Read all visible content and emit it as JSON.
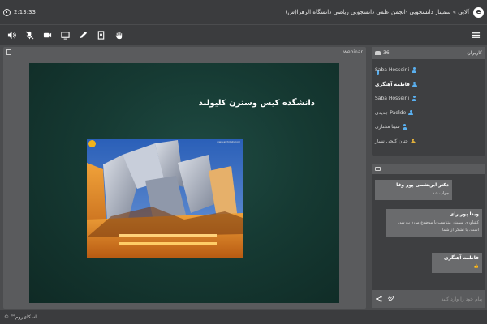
{
  "header": {
    "timer": "2:13:33",
    "breadcrumb": "آلابی » سمینار دانشجویی -انجمن علمی دانشجویی ریاضی دانشگاه الزهرا(س)",
    "logo_letter": "e"
  },
  "toolbar": {
    "icons": [
      "speaker-icon",
      "mic-off-icon",
      "camera-icon",
      "screen-share-icon",
      "pen-icon",
      "document-icon",
      "raise-hand-icon"
    ],
    "menu_icon": "hamburger-menu-icon"
  },
  "presentation": {
    "header_label": "webinar",
    "slide_title": "دانشگده کیس وسترن کلیولند",
    "photo_caption": "www.archdaily.com"
  },
  "users": {
    "header_label": "کاربران",
    "count": "36",
    "list": [
      {
        "name": "Saba Hosseini",
        "type": "member"
      },
      {
        "name": "فاطمه آهنگری",
        "type": "me"
      },
      {
        "name": "Saba Hosseini",
        "type": "member"
      },
      {
        "name": "Padide جدیدی",
        "type": "member"
      },
      {
        "name": "سینا مختاری",
        "type": "member"
      },
      {
        "name": "جنان گنجی نسار",
        "type": "guest"
      }
    ]
  },
  "chat": {
    "messages": [
      {
        "name": "دکتر ابریشمی پور وفا",
        "text": "جواب شد"
      },
      {
        "name": "ویدا پور رای",
        "text": "کشاوری سمینار متناسب با موضوع مورد بررسی است. با تشکر از شما"
      },
      {
        "name": "فاطمه آهنگری",
        "text": "👍"
      }
    ],
    "input_placeholder": "پیام خود را وارد کنید"
  },
  "footer": {
    "brand": "اسکای‌روم™ ©"
  },
  "colors": {
    "background": "#4b4c4e",
    "bar": "#3b3c3e",
    "panel": "#3e3f41",
    "accent": "#5ab0f0",
    "slide": "#163a33"
  }
}
